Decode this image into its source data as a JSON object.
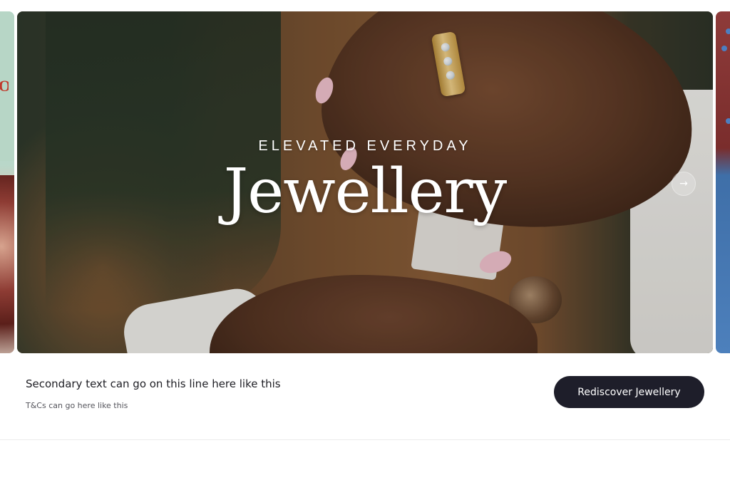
{
  "hero": {
    "eyebrow": "ELEVATED EVERYDAY",
    "headline": "Jewellery",
    "next_arrow_glyph": "→"
  },
  "promo": {
    "secondary_text": "Secondary text can go on this line here like this",
    "tcs_text": "T&Cs can go here like this",
    "cta_label": "Rediscover Jewellery"
  },
  "peek_left": {
    "visible_letter": "OH"
  },
  "colors": {
    "cta_background": "#1e1e2a",
    "hero_text": "#ffffff",
    "body_text": "#1e1e24"
  },
  "icons": {
    "next_arrow": "arrow-right-icon"
  }
}
